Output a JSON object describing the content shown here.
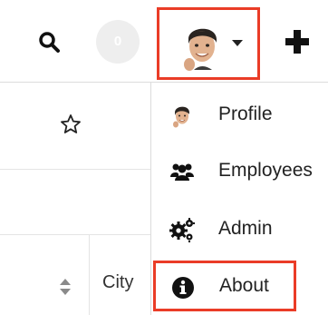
{
  "topbar": {
    "search_icon": "search-icon",
    "notification_count": "0",
    "user_avatar_icon": "avatar-icon",
    "caret_icon": "chevron-down-icon",
    "add_icon": "plus-icon"
  },
  "background": {
    "city_column_header": "City",
    "star_icon": "star-icon",
    "sort_icon": "sort-icon"
  },
  "user_menu": {
    "items": [
      {
        "label": "Profile",
        "icon": "avatar-icon"
      },
      {
        "label": "Employees",
        "icon": "users-icon"
      },
      {
        "label": "Admin",
        "icon": "gears-icon"
      },
      {
        "label": "About",
        "icon": "info-icon"
      }
    ]
  },
  "colors": {
    "highlight": "#ea3c27",
    "badge_bg": "#eeeeee",
    "text": "#222222",
    "border": "#dcdcdc"
  }
}
